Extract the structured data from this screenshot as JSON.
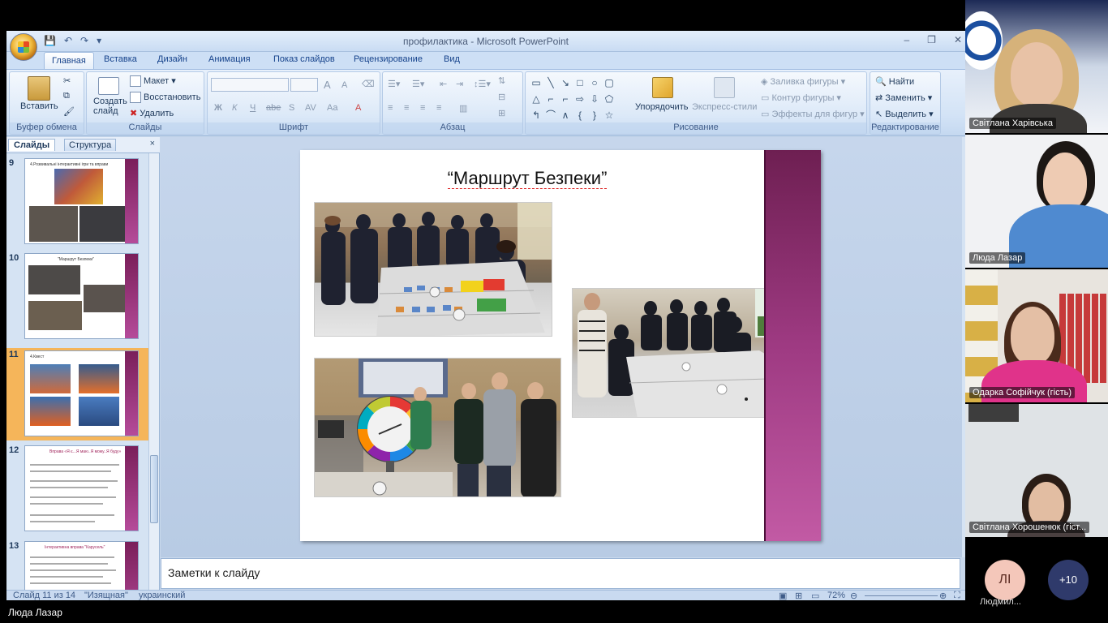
{
  "window": {
    "title": "профилактика - Microsoft PowerPoint"
  },
  "tabs": [
    "Главная",
    "Вставка",
    "Дизайн",
    "Анимация",
    "Показ слайдов",
    "Рецензирование",
    "Вид"
  ],
  "ribbon": {
    "clipboard": {
      "label": "Буфер обмена",
      "paste": "Вставить"
    },
    "slides": {
      "label": "Слайды",
      "new_slide": "Создать слайд",
      "layout": "Макет",
      "reset": "Восстановить",
      "delete": "Удалить"
    },
    "font": {
      "label": "Шрифт",
      "bold": "Ж",
      "italic": "К",
      "underline": "Ч",
      "strike": "abe",
      "shadow": "S",
      "spacing": "AV",
      "case": "Aa",
      "grow": "A",
      "shrink": "A"
    },
    "paragraph": {
      "label": "Абзац"
    },
    "drawing": {
      "label": "Рисование",
      "arrange": "Упорядочить",
      "quick_styles": "Экспресс-стили",
      "fill": "Заливка фигуры",
      "outline": "Контур фигуры",
      "effects": "Эффекты для фигур"
    },
    "editing": {
      "label": "Редактирование",
      "find": "Найти",
      "replace": "Заменить",
      "select": "Выделить"
    }
  },
  "pane": {
    "tab_slides": "Слайды",
    "tab_outline": "Структура",
    "close": "×"
  },
  "thumbnails": [
    {
      "num": "9",
      "title": "4.Розвивальні інтерактивні ігри та вправи"
    },
    {
      "num": "10",
      "title": "\"Маршрут Безпеки\""
    },
    {
      "num": "11",
      "title": "4.Квест"
    },
    {
      "num": "12",
      "title": "Вправа «Я є...Я маю..Я можу..Я буду»"
    },
    {
      "num": "13",
      "title": "Інтерактивна вправа \"Карусель\""
    }
  ],
  "slide": {
    "title": "“Маршрут Безпеки”"
  },
  "notes": {
    "placeholder": "Заметки к слайду"
  },
  "status": {
    "slide": "Слайд 11 из 14",
    "theme": "\"Изящная\"",
    "lang": "украинский",
    "zoom": "72%"
  },
  "participants": [
    {
      "name": "Світлана Харівська"
    },
    {
      "name": "Люда Лазар"
    },
    {
      "name": "Одарка Софійчук (гість)"
    },
    {
      "name": "Світлана Хорошенюк (гіст..."
    }
  ],
  "bottom": {
    "current_speaker": "Люда Лазар",
    "avatar_initials": "ЛІ",
    "avatar_name": "Людмил...",
    "more_count": "+10"
  }
}
